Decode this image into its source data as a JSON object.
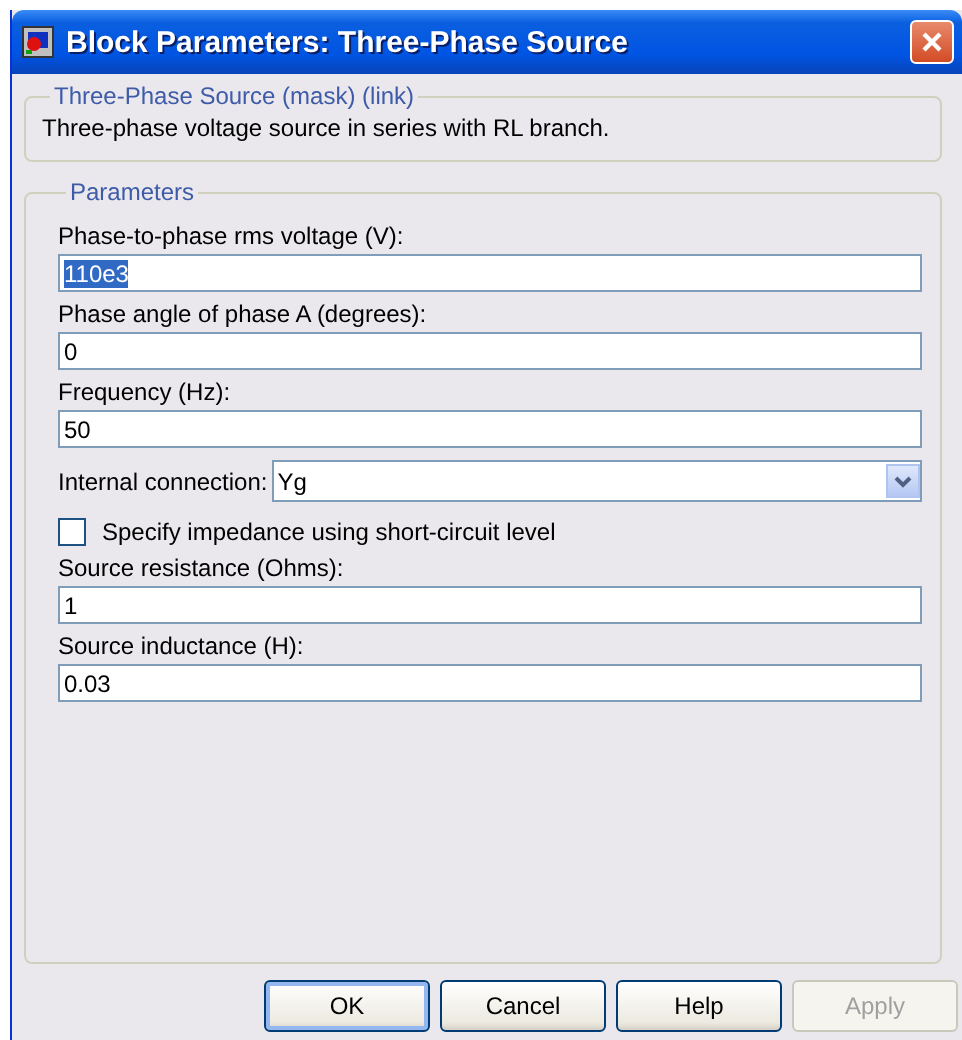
{
  "window": {
    "title": "Block Parameters: Three-Phase Source"
  },
  "description_group": {
    "title": "Three-Phase Source (mask) (link)",
    "text": "Three-phase voltage source in series with RL branch."
  },
  "parameters": {
    "title": "Parameters",
    "items": [
      {
        "kind": "text",
        "label": "Phase-to-phase rms voltage (V):",
        "value": "110e3",
        "highlighted": true
      },
      {
        "kind": "text",
        "label": "Phase angle of phase A (degrees):",
        "value": "0",
        "highlighted": false
      },
      {
        "kind": "text",
        "label": "Frequency (Hz):",
        "value": "50",
        "highlighted": false
      },
      {
        "kind": "dropdown",
        "label": "Internal connection:",
        "value": "Yg"
      },
      {
        "kind": "checkbox",
        "label": "Specify impedance using short-circuit level",
        "checked": false
      },
      {
        "kind": "text",
        "label": "Source resistance (Ohms):",
        "value": "1",
        "highlighted": false
      },
      {
        "kind": "text",
        "label": "Source inductance (H):",
        "value": "0.03",
        "highlighted": false
      }
    ]
  },
  "buttons": [
    {
      "label": "OK",
      "default": true,
      "disabled": false
    },
    {
      "label": "Cancel",
      "default": false,
      "disabled": false
    },
    {
      "label": "Help",
      "default": false,
      "disabled": false
    },
    {
      "label": "Apply",
      "default": false,
      "disabled": true
    }
  ]
}
